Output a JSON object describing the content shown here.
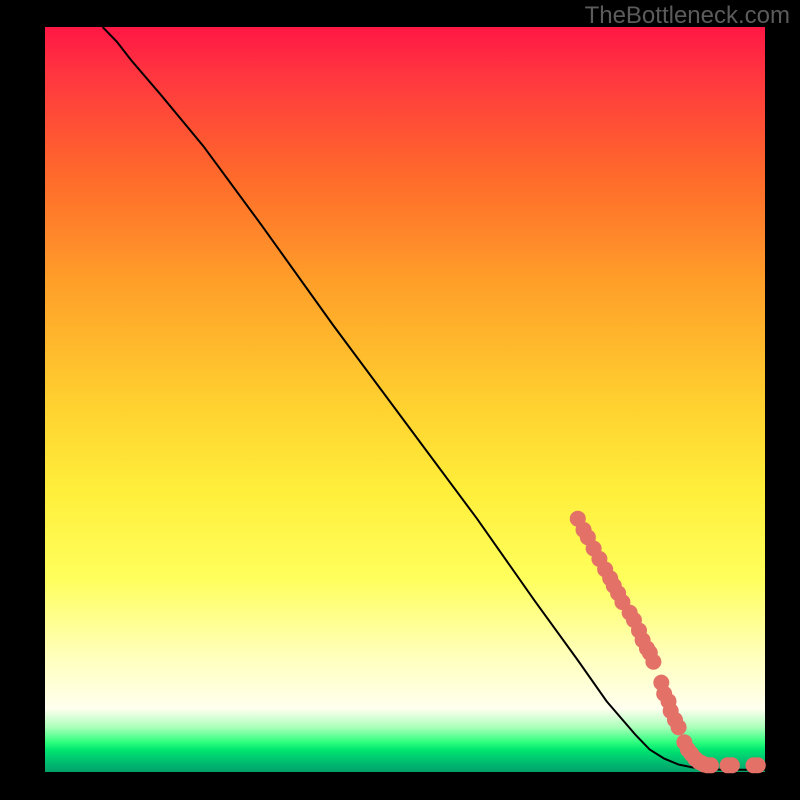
{
  "watermark": "TheBottleneck.com",
  "chart_data": {
    "type": "line",
    "title": "",
    "xlabel": "",
    "ylabel": "",
    "xlim": [
      0,
      100
    ],
    "ylim": [
      0,
      100
    ],
    "background": "rainbow-gradient red(top) to green(bottom)",
    "line_series": {
      "name": "bottleneck-curve",
      "description": "Monotone decreasing curve from top-left to bottom-right, then flat along bottom",
      "x": [
        8,
        10,
        12,
        16,
        22,
        30,
        40,
        50,
        60,
        68,
        74,
        78,
        82,
        84,
        86,
        88,
        90,
        92,
        94,
        96,
        98,
        100
      ],
      "y": [
        100,
        98,
        95.5,
        91,
        84,
        73.5,
        60,
        47,
        34,
        23,
        15,
        9.5,
        5,
        3,
        1.8,
        1,
        0.6,
        0.4,
        0.3,
        0.3,
        0.3,
        0.3
      ]
    },
    "scatter_series": {
      "name": "data-points",
      "description": "Individual measured points (salmon dots) clustered along lower-right segment of the curve",
      "points": [
        {
          "x": 74.0,
          "y": 34.0
        },
        {
          "x": 74.8,
          "y": 32.5
        },
        {
          "x": 75.4,
          "y": 31.5
        },
        {
          "x": 76.2,
          "y": 30.0
        },
        {
          "x": 77.0,
          "y": 28.6
        },
        {
          "x": 77.8,
          "y": 27.2
        },
        {
          "x": 78.5,
          "y": 26.0
        },
        {
          "x": 79.0,
          "y": 25.0
        },
        {
          "x": 79.6,
          "y": 24.0
        },
        {
          "x": 80.2,
          "y": 22.8
        },
        {
          "x": 81.2,
          "y": 21.4
        },
        {
          "x": 81.8,
          "y": 20.4
        },
        {
          "x": 82.5,
          "y": 19.0
        },
        {
          "x": 83.0,
          "y": 17.7
        },
        {
          "x": 83.6,
          "y": 16.6
        },
        {
          "x": 84.0,
          "y": 16.0
        },
        {
          "x": 84.5,
          "y": 14.8
        },
        {
          "x": 85.6,
          "y": 12.0
        },
        {
          "x": 86.0,
          "y": 10.5
        },
        {
          "x": 86.6,
          "y": 9.5
        },
        {
          "x": 86.9,
          "y": 8.2
        },
        {
          "x": 87.5,
          "y": 7.0
        },
        {
          "x": 88.0,
          "y": 6.0
        },
        {
          "x": 88.8,
          "y": 4.0
        },
        {
          "x": 89.3,
          "y": 3.0
        },
        {
          "x": 89.8,
          "y": 2.4
        },
        {
          "x": 90.3,
          "y": 1.8
        },
        {
          "x": 90.8,
          "y": 1.4
        },
        {
          "x": 91.2,
          "y": 1.2
        },
        {
          "x": 91.6,
          "y": 1.0
        },
        {
          "x": 92.0,
          "y": 0.9
        },
        {
          "x": 92.5,
          "y": 0.9
        },
        {
          "x": 94.8,
          "y": 0.9
        },
        {
          "x": 95.4,
          "y": 0.9
        },
        {
          "x": 98.4,
          "y": 0.9
        },
        {
          "x": 99.0,
          "y": 0.9
        }
      ]
    }
  }
}
